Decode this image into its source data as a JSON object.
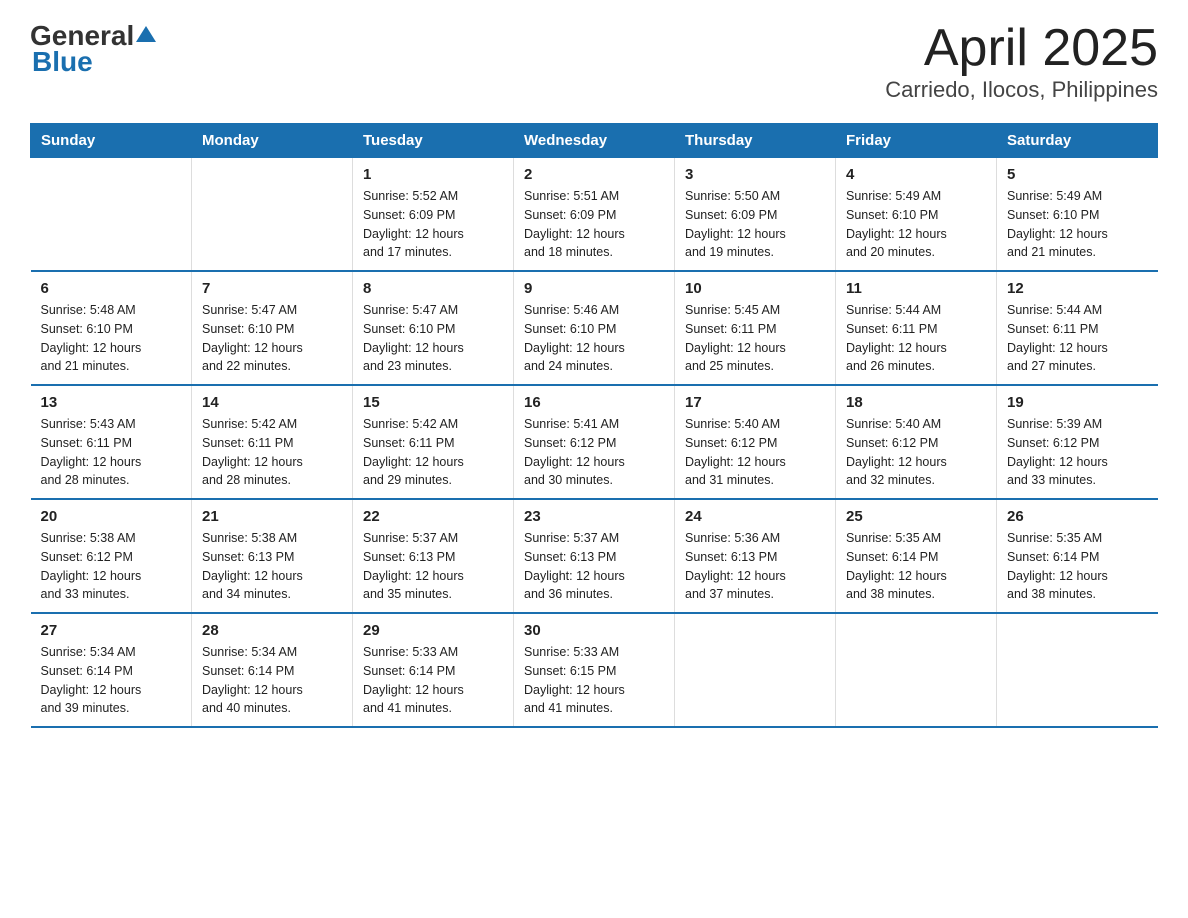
{
  "header": {
    "logo_general": "General",
    "logo_blue": "Blue",
    "title": "April 2025",
    "subtitle": "Carriedo, Ilocos, Philippines"
  },
  "weekdays": [
    "Sunday",
    "Monday",
    "Tuesday",
    "Wednesday",
    "Thursday",
    "Friday",
    "Saturday"
  ],
  "weeks": [
    [
      {
        "day": "",
        "info": ""
      },
      {
        "day": "",
        "info": ""
      },
      {
        "day": "1",
        "info": "Sunrise: 5:52 AM\nSunset: 6:09 PM\nDaylight: 12 hours\nand 17 minutes."
      },
      {
        "day": "2",
        "info": "Sunrise: 5:51 AM\nSunset: 6:09 PM\nDaylight: 12 hours\nand 18 minutes."
      },
      {
        "day": "3",
        "info": "Sunrise: 5:50 AM\nSunset: 6:09 PM\nDaylight: 12 hours\nand 19 minutes."
      },
      {
        "day": "4",
        "info": "Sunrise: 5:49 AM\nSunset: 6:10 PM\nDaylight: 12 hours\nand 20 minutes."
      },
      {
        "day": "5",
        "info": "Sunrise: 5:49 AM\nSunset: 6:10 PM\nDaylight: 12 hours\nand 21 minutes."
      }
    ],
    [
      {
        "day": "6",
        "info": "Sunrise: 5:48 AM\nSunset: 6:10 PM\nDaylight: 12 hours\nand 21 minutes."
      },
      {
        "day": "7",
        "info": "Sunrise: 5:47 AM\nSunset: 6:10 PM\nDaylight: 12 hours\nand 22 minutes."
      },
      {
        "day": "8",
        "info": "Sunrise: 5:47 AM\nSunset: 6:10 PM\nDaylight: 12 hours\nand 23 minutes."
      },
      {
        "day": "9",
        "info": "Sunrise: 5:46 AM\nSunset: 6:10 PM\nDaylight: 12 hours\nand 24 minutes."
      },
      {
        "day": "10",
        "info": "Sunrise: 5:45 AM\nSunset: 6:11 PM\nDaylight: 12 hours\nand 25 minutes."
      },
      {
        "day": "11",
        "info": "Sunrise: 5:44 AM\nSunset: 6:11 PM\nDaylight: 12 hours\nand 26 minutes."
      },
      {
        "day": "12",
        "info": "Sunrise: 5:44 AM\nSunset: 6:11 PM\nDaylight: 12 hours\nand 27 minutes."
      }
    ],
    [
      {
        "day": "13",
        "info": "Sunrise: 5:43 AM\nSunset: 6:11 PM\nDaylight: 12 hours\nand 28 minutes."
      },
      {
        "day": "14",
        "info": "Sunrise: 5:42 AM\nSunset: 6:11 PM\nDaylight: 12 hours\nand 28 minutes."
      },
      {
        "day": "15",
        "info": "Sunrise: 5:42 AM\nSunset: 6:11 PM\nDaylight: 12 hours\nand 29 minutes."
      },
      {
        "day": "16",
        "info": "Sunrise: 5:41 AM\nSunset: 6:12 PM\nDaylight: 12 hours\nand 30 minutes."
      },
      {
        "day": "17",
        "info": "Sunrise: 5:40 AM\nSunset: 6:12 PM\nDaylight: 12 hours\nand 31 minutes."
      },
      {
        "day": "18",
        "info": "Sunrise: 5:40 AM\nSunset: 6:12 PM\nDaylight: 12 hours\nand 32 minutes."
      },
      {
        "day": "19",
        "info": "Sunrise: 5:39 AM\nSunset: 6:12 PM\nDaylight: 12 hours\nand 33 minutes."
      }
    ],
    [
      {
        "day": "20",
        "info": "Sunrise: 5:38 AM\nSunset: 6:12 PM\nDaylight: 12 hours\nand 33 minutes."
      },
      {
        "day": "21",
        "info": "Sunrise: 5:38 AM\nSunset: 6:13 PM\nDaylight: 12 hours\nand 34 minutes."
      },
      {
        "day": "22",
        "info": "Sunrise: 5:37 AM\nSunset: 6:13 PM\nDaylight: 12 hours\nand 35 minutes."
      },
      {
        "day": "23",
        "info": "Sunrise: 5:37 AM\nSunset: 6:13 PM\nDaylight: 12 hours\nand 36 minutes."
      },
      {
        "day": "24",
        "info": "Sunrise: 5:36 AM\nSunset: 6:13 PM\nDaylight: 12 hours\nand 37 minutes."
      },
      {
        "day": "25",
        "info": "Sunrise: 5:35 AM\nSunset: 6:14 PM\nDaylight: 12 hours\nand 38 minutes."
      },
      {
        "day": "26",
        "info": "Sunrise: 5:35 AM\nSunset: 6:14 PM\nDaylight: 12 hours\nand 38 minutes."
      }
    ],
    [
      {
        "day": "27",
        "info": "Sunrise: 5:34 AM\nSunset: 6:14 PM\nDaylight: 12 hours\nand 39 minutes."
      },
      {
        "day": "28",
        "info": "Sunrise: 5:34 AM\nSunset: 6:14 PM\nDaylight: 12 hours\nand 40 minutes."
      },
      {
        "day": "29",
        "info": "Sunrise: 5:33 AM\nSunset: 6:14 PM\nDaylight: 12 hours\nand 41 minutes."
      },
      {
        "day": "30",
        "info": "Sunrise: 5:33 AM\nSunset: 6:15 PM\nDaylight: 12 hours\nand 41 minutes."
      },
      {
        "day": "",
        "info": ""
      },
      {
        "day": "",
        "info": ""
      },
      {
        "day": "",
        "info": ""
      }
    ]
  ]
}
